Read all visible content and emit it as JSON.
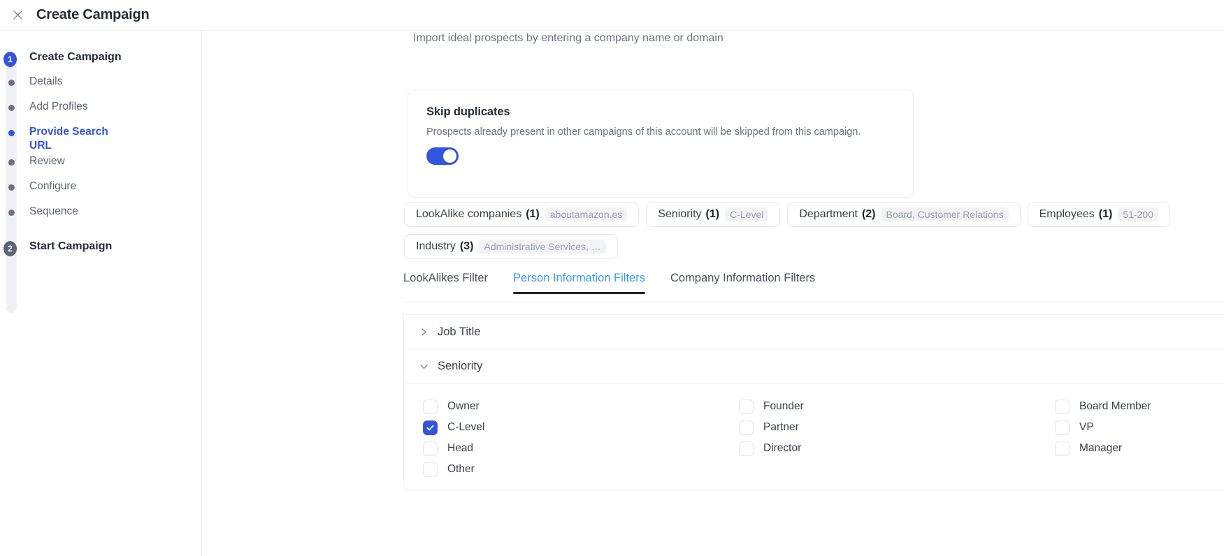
{
  "window": {
    "title": "Create Campaign",
    "close_icon": "close-icon"
  },
  "sidebar": {
    "steps": [
      {
        "marker": "1",
        "label": "Create Campaign",
        "type": "major",
        "state": "done"
      },
      {
        "marker": "dot",
        "label": "Details",
        "type": "sub",
        "state": "default"
      },
      {
        "marker": "dot",
        "label": "Add Profiles",
        "type": "sub",
        "state": "default"
      },
      {
        "marker": "dot",
        "label": "Provide Search URL",
        "type": "sub",
        "state": "current"
      },
      {
        "marker": "dot",
        "label": "Review",
        "type": "sub",
        "state": "default"
      },
      {
        "marker": "dot",
        "label": "Configure",
        "type": "sub",
        "state": "default"
      },
      {
        "marker": "dot",
        "label": "Sequence",
        "type": "sub",
        "state": "default"
      },
      {
        "marker": "2",
        "label": "Start Campaign",
        "type": "major",
        "state": "default"
      }
    ]
  },
  "main": {
    "scrolled_off_text": "Import ideal prospects by entering a company name or domain",
    "skip_duplicates": {
      "title": "Skip duplicates",
      "description": "Prospects already present in other campaigns of this account will be skipped from this campaign.",
      "toggle_on": true
    },
    "filter_chips": [
      {
        "label": "LookAlike companies",
        "count": "(1)",
        "value": "aboutamazon.es"
      },
      {
        "label": "Seniority",
        "count": "(1)",
        "value": "C-Level"
      },
      {
        "label": "Department",
        "count": "(2)",
        "value": "Board, Customer Relations"
      },
      {
        "label": "Employees",
        "count": "(1)",
        "value": "51-200"
      },
      {
        "label": "Industry",
        "count": "(3)",
        "value": "Administrative Services, …"
      }
    ],
    "tabs": [
      {
        "label": "LookAlikes Filter",
        "active": false
      },
      {
        "label": "Person Information Filters",
        "active": true
      },
      {
        "label": "Company Information Filters",
        "active": false
      }
    ],
    "accordions": [
      {
        "title": "Job Title",
        "expanded": false,
        "icon": "chevron-right-icon"
      },
      {
        "title": "Seniority",
        "expanded": true,
        "icon": "chevron-down-icon"
      }
    ],
    "seniority_options": [
      {
        "label": "Owner",
        "checked": false
      },
      {
        "label": "Founder",
        "checked": false
      },
      {
        "label": "Board Member",
        "checked": false
      },
      {
        "label": "C-Level",
        "checked": true
      },
      {
        "label": "Partner",
        "checked": false
      },
      {
        "label": "VP",
        "checked": false
      },
      {
        "label": "Head",
        "checked": false
      },
      {
        "label": "Director",
        "checked": false
      },
      {
        "label": "Manager",
        "checked": false
      },
      {
        "label": "Other",
        "checked": false
      },
      {
        "label": "",
        "checked": false
      },
      {
        "label": "",
        "checked": false
      }
    ]
  },
  "colors": {
    "accent_blue": "#3355dd",
    "tab_active": "#3a9bf0",
    "muted": "#6b7280",
    "rail": "#f0f1f4"
  }
}
